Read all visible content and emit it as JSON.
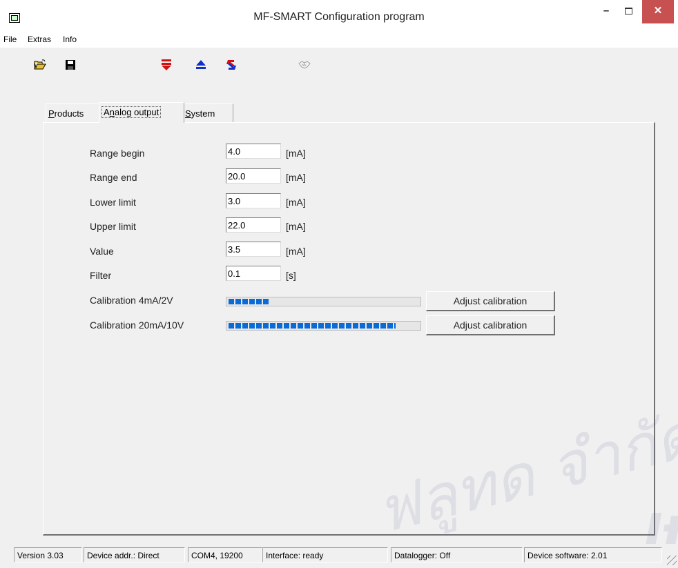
{
  "window": {
    "title": "MF-SMART Configuration program",
    "minimize": "–",
    "close": "✕"
  },
  "menu": [
    "File",
    "Extras",
    "Info"
  ],
  "toolbar": [
    "open-folder-icon",
    "save-disk-icon",
    "download-icon",
    "eject-icon",
    "transfer-icon",
    "handshake-icon"
  ],
  "tabs": [
    {
      "label_pre": "",
      "label_key": "P",
      "label_post": "roducts"
    },
    {
      "label_pre": "A",
      "label_key": "n",
      "label_post": "alog output"
    },
    {
      "label_pre": "",
      "label_key": "S",
      "label_post": "ystem"
    }
  ],
  "form": {
    "range_begin": {
      "label": "Range begin",
      "value": "4.0",
      "unit": "[mA]"
    },
    "range_end": {
      "label": "Range end",
      "value": "20.0",
      "unit": "[mA]"
    },
    "lower_limit": {
      "label": "Lower limit",
      "value": "3.0",
      "unit": "[mA]"
    },
    "upper_limit": {
      "label": "Upper limit",
      "value": "22.0",
      "unit": "[mA]"
    },
    "value": {
      "label": "Value",
      "value": "3.5",
      "unit": "[mA]"
    },
    "filter": {
      "label": "Filter",
      "value": "0.1",
      "unit": "[s]"
    }
  },
  "calibration": [
    {
      "label": "Calibration 4mA/2V",
      "progress": 0.21,
      "button": "Adjust calibration"
    },
    {
      "label": "Calibration 20mA/10V",
      "progress": 0.88,
      "button": "Adjust calibration"
    }
  ],
  "status": {
    "version": "Version 3.03",
    "device_addr": "Device addr.: Direct",
    "com": "COM4,  19200",
    "interface": "Interface: ready",
    "datalogger": "Datalogger: Off",
    "device_software": "Device software: 2.01"
  },
  "watermark": {
    "thai": "ฟลูทด จำกัด",
    "latin": "ltc"
  },
  "colors": {
    "progress": "#0a6bd8",
    "close": "#c75050"
  }
}
